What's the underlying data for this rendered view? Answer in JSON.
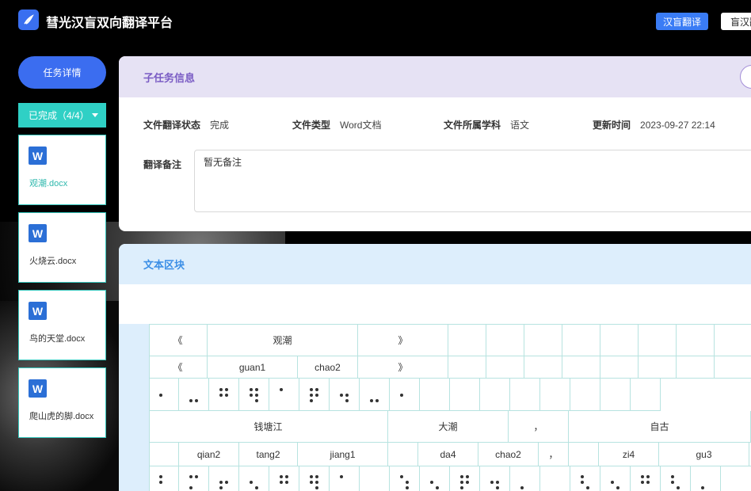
{
  "header": {
    "app_title": "彗光汉盲双向翻译平台",
    "han_to_braille_button": "汉盲翻译",
    "braille_to_han_button": "盲汉翻译"
  },
  "sidebar": {
    "task_detail_button": "任务详情",
    "status_dropdown": "已完成（4/4）",
    "files": [
      {
        "icon": "W",
        "name": "观潮.docx",
        "active": true
      },
      {
        "icon": "W",
        "name": "火烧云.docx",
        "active": false
      },
      {
        "icon": "W",
        "name": "鸟的天堂.docx",
        "active": false
      },
      {
        "icon": "W",
        "name": "爬山虎的脚.docx",
        "active": false
      }
    ]
  },
  "subtask": {
    "title": "子任务信息",
    "fields": [
      {
        "label": "文件翻译状态",
        "value": "完成"
      },
      {
        "label": "文件类型",
        "value": "Word文档"
      },
      {
        "label": "文件所属学科",
        "value": "语文"
      },
      {
        "label": "更新时间",
        "value": "2023-09-27 22:14"
      }
    ],
    "note_label": "翻译备注",
    "note_value": "暂无备注"
  },
  "text_block": {
    "title": "文本区块",
    "row1": [
      "《",
      "观潮",
      "》"
    ],
    "row2": [
      "《",
      "guan1",
      "chao2",
      "》"
    ],
    "row4": [
      "钱塘江",
      "大潮",
      "，",
      "自古"
    ],
    "row5": [
      "qian2",
      "tang2",
      "jiang1",
      "da4",
      "chao2",
      "，",
      "zi4",
      "gu3"
    ]
  },
  "colors": {
    "accent_blue": "#3b6df0",
    "teal": "#2fd0c5",
    "subtask_header_bg": "#e6e2f4",
    "textblock_header_bg": "#ddeefc"
  }
}
